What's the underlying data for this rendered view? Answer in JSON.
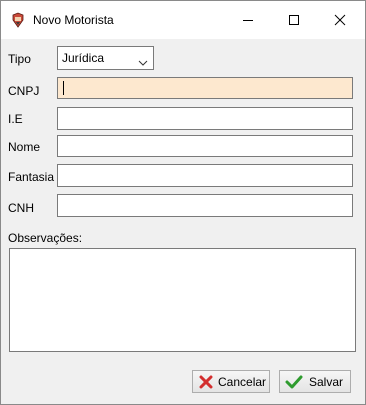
{
  "window": {
    "title": "Novo Motorista"
  },
  "form": {
    "tipo_label": "Tipo",
    "tipo_value": "Jurídica",
    "cnpj_label": "CNPJ",
    "cnpj_value": "",
    "ie_label": "I.E",
    "ie_value": "",
    "nome_label": "Nome",
    "nome_value": "",
    "fantasia_label": "Fantasia",
    "fantasia_value": "",
    "cnh_label": "CNH",
    "cnh_value": "",
    "observacoes_label": "Observações:",
    "observacoes_value": ""
  },
  "buttons": {
    "cancel_label": "Cancelar",
    "save_label": "Salvar"
  },
  "colors": {
    "focused_field_bg": "#fde8cf",
    "cancel_icon": "#d32f2f",
    "save_icon": "#2e9b2e"
  },
  "icons": {
    "app": "app-icon",
    "minimize": "minimize-icon",
    "maximize": "maximize-icon",
    "close": "close-icon",
    "dropdown": "chevron-down-icon",
    "cancel": "x-icon",
    "save": "checkmark-icon"
  }
}
